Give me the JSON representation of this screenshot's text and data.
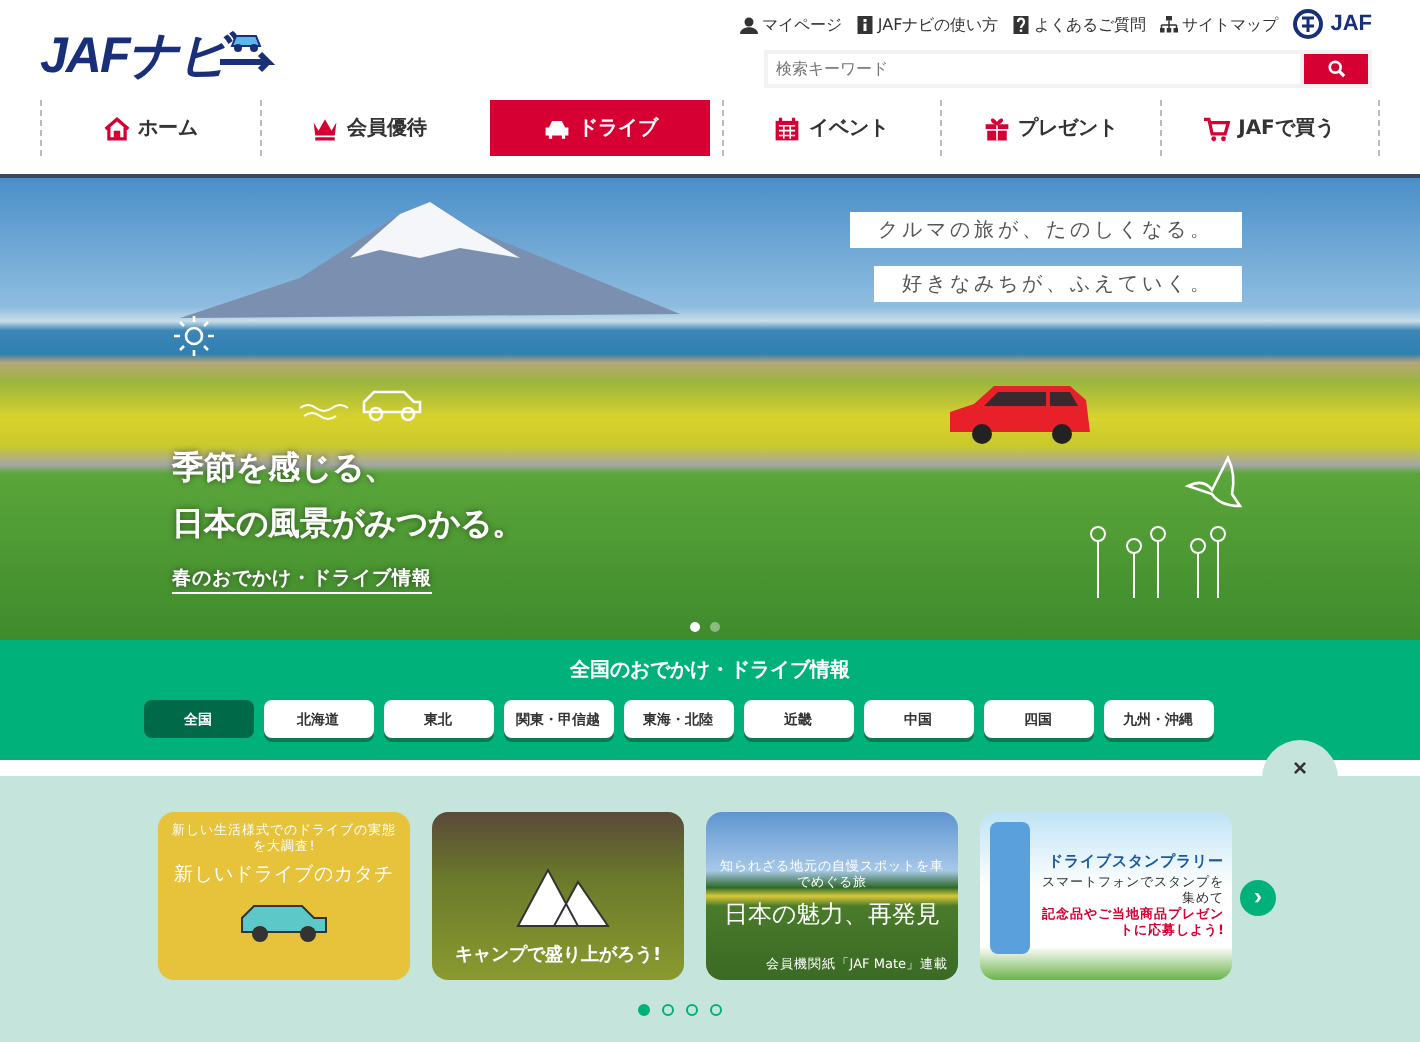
{
  "header": {
    "logo": "JAFナビ",
    "top_links": [
      "マイページ",
      "JAFナビの使い方",
      "よくあるご質問",
      "サイトマップ"
    ],
    "brand": "JAF",
    "search": {
      "placeholder": "検索キーワード"
    }
  },
  "nav": [
    {
      "label": "ホーム",
      "selected": false
    },
    {
      "label": "会員優待",
      "selected": false
    },
    {
      "label": "ドライブ",
      "selected": true
    },
    {
      "label": "イベント",
      "selected": false
    },
    {
      "label": "プレゼント",
      "selected": false
    },
    {
      "label": "JAFで買う",
      "selected": false
    }
  ],
  "hero": {
    "taglines": [
      "クルマの旅が、たのしくなる。",
      "好きなみちが、ふえていく。"
    ],
    "headline": [
      "季節を感じる、",
      "日本の風景がみつかる。"
    ],
    "link": "春のおでかけ・ドライブ情報",
    "dots": [
      {
        "selected": true
      },
      {
        "selected": false
      }
    ]
  },
  "regions": {
    "title": "全国のおでかけ・ドライブ情報",
    "items": [
      {
        "label": "全国",
        "selected": true
      },
      {
        "label": "北海道",
        "selected": false
      },
      {
        "label": "東北",
        "selected": false
      },
      {
        "label": "関東・甲信越",
        "selected": false
      },
      {
        "label": "東海・北陸",
        "selected": false
      },
      {
        "label": "近畿",
        "selected": false
      },
      {
        "label": "中国",
        "selected": false
      },
      {
        "label": "四国",
        "selected": false
      },
      {
        "label": "九州・沖縄",
        "selected": false
      }
    ]
  },
  "carousel": {
    "close": "×",
    "next": "›",
    "cards": [
      {
        "kind": "illustration",
        "caption": "新しい生活様式でのドライブの実態を大調査!",
        "title": "新しいドライブのカタチ"
      },
      {
        "kind": "camp",
        "title": "キャンプで盛り上がろう!"
      },
      {
        "kind": "scenery",
        "caption": "知られざる地元の自慢スポットを車でめぐる旅",
        "title": "日本の魅力、再発見",
        "note": "会員機関紙「JAF Mate」連載"
      },
      {
        "kind": "stamp",
        "title": "ドライブスタンプラリー",
        "caption": "スマートフォンでスタンプを集めて",
        "note": "記念品やご当地商品プレゼントに応募しよう!"
      }
    ],
    "dots": [
      {
        "selected": true
      },
      {
        "selected": false
      },
      {
        "selected": false
      },
      {
        "selected": false
      }
    ]
  }
}
